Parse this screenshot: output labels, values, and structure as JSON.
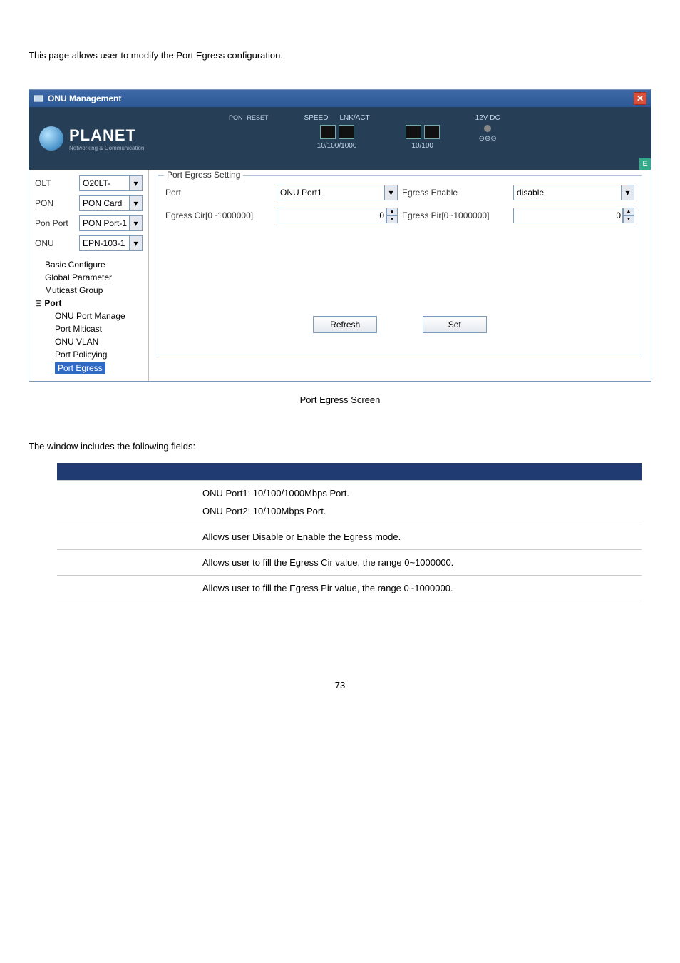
{
  "intro": "This page allows user to modify the Port Egress configuration.",
  "window": {
    "title": "ONU Management",
    "close": "✕"
  },
  "banner": {
    "brand": "PLANET",
    "sub": "Networking & Communication",
    "speed": "SPEED",
    "lnkact": "LNK/ACT",
    "pon": "PON",
    "reset": "RESET",
    "port1": "10/100/1000",
    "port2": "10/100",
    "power": "12V DC",
    "leds": "⊝⊛⊝",
    "e": "E"
  },
  "sidebar": {
    "rows": [
      {
        "label": "OLT",
        "value": "O20LT-"
      },
      {
        "label": "PON",
        "value": "PON Card"
      },
      {
        "label": "Pon Port",
        "value": "PON Port-1"
      },
      {
        "label": "ONU",
        "value": "EPN-103-1"
      }
    ],
    "tree": {
      "items": [
        "Basic Configure",
        "Global Parameter",
        "Muticast Group"
      ],
      "port_label": "Port",
      "sub": [
        "ONU Port Manage",
        "Port Miticast",
        "ONU VLAN",
        "Port Policying",
        "Port Egress"
      ]
    }
  },
  "form": {
    "legend": "Port Egress Setting",
    "port_label": "Port",
    "port_value": "ONU Port1",
    "egress_enable_label": "Egress Enable",
    "egress_enable_value": "disable",
    "cir_label": "Egress Cir[0~1000000]",
    "cir_value": "0",
    "pir_label": "Egress Pir[0~1000000]",
    "pir_value": "0",
    "refresh": "Refresh",
    "set": "Set"
  },
  "caption": "Port Egress Screen",
  "fields_intro": "The window includes the following fields:",
  "table": {
    "rows": [
      {
        "obj": "",
        "desc1": "ONU Port1: 10/100/1000Mbps Port.",
        "desc2": "ONU Port2: 10/100Mbps Port."
      },
      {
        "obj": "",
        "desc1": "Allows user Disable or Enable the Egress mode."
      },
      {
        "obj": "",
        "desc1": "Allows user to fill the Egress Cir value, the range 0~1000000."
      },
      {
        "obj": "",
        "desc1": "Allows user to fill the Egress Pir value, the range 0~1000000."
      }
    ]
  },
  "pagenum": "73"
}
